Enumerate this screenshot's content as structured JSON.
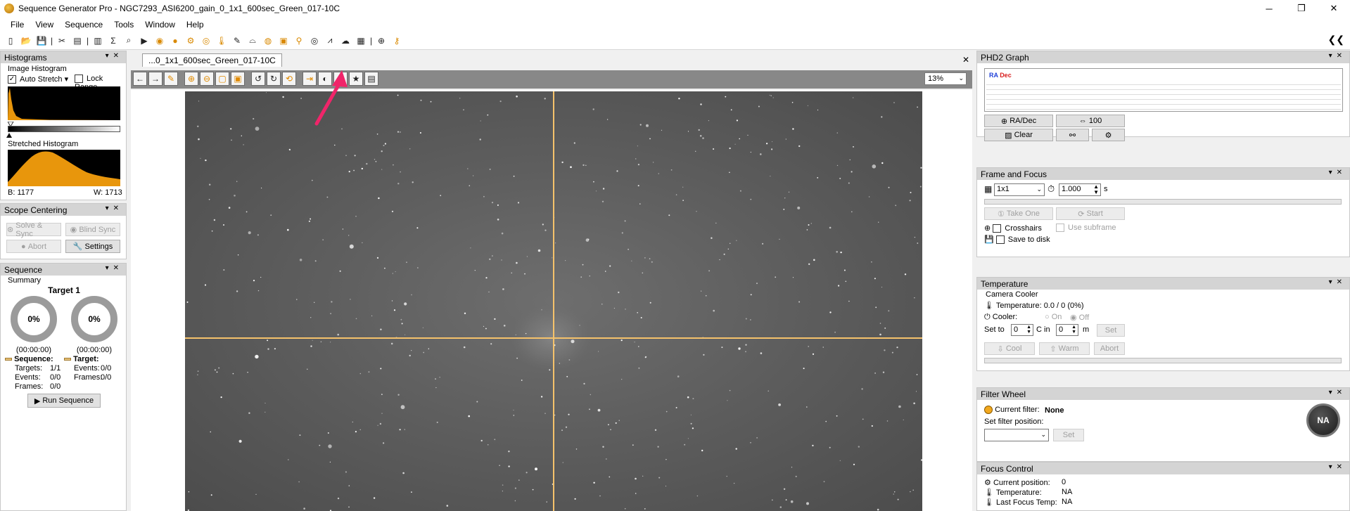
{
  "app": {
    "title": "Sequence Generator Pro - NGC7293_ASI6200_gain_0_1x1_600sec_Green_017-10C",
    "window_buttons": [
      "─",
      "❐",
      "✕"
    ]
  },
  "menu": [
    "File",
    "View",
    "Sequence",
    "Tools",
    "Window",
    "Help"
  ],
  "toolbar": {
    "right_label": "❮❮"
  },
  "histograms": {
    "title": "Histograms",
    "image_histogram_label": "Image Histogram",
    "auto_stretch_label": "Auto Stretch",
    "lock_range_label": "Lock Range",
    "stretched_histogram_label": "Stretched Histogram",
    "black_point": "B: 1177",
    "white_point": "W:   1713",
    "accent_color": "#e8960c"
  },
  "scope_centering": {
    "title": "Scope Centering",
    "solve_sync_label": "Solve & Sync",
    "blind_sync_label": "Blind Sync",
    "abort_label": "Abort",
    "settings_label": "Settings"
  },
  "sequence": {
    "title": "Sequence",
    "summary_label": "Summary",
    "target_name": "Target 1",
    "sequence_progress": "0%",
    "target_progress": "0%",
    "sequence_time": "(00:00:00)",
    "target_time": "(00:00:00)",
    "sequence_header": "Sequence:",
    "target_header": "Target:",
    "sequence_stats": [
      {
        "label": "Targets:",
        "value": "1/1"
      },
      {
        "label": "Events:",
        "value": "0/0"
      },
      {
        "label": "Frames:",
        "value": "0/0"
      }
    ],
    "target_stats": [
      {
        "label": "Events:",
        "value": "0/0"
      },
      {
        "label": "Frames:",
        "value": "0/0"
      }
    ],
    "run_label": "Run Sequence"
  },
  "document": {
    "tab_label": "...0_1x1_600sec_Green_017-10C",
    "zoom_value": "13%",
    "crosshair_color": "#f5c26b"
  },
  "phd2": {
    "title": "PHD2 Graph",
    "legend_ra": "RA",
    "legend_dec": "Dec",
    "radec_label": "RA/Dec",
    "scale_label": "100",
    "clear_label": "Clear"
  },
  "frame_focus": {
    "title": "Frame and Focus",
    "binning_value": "1x1",
    "exposure_value": "1.000",
    "exposure_unit": "s",
    "take_one_label": "Take One",
    "start_label": "Start",
    "crosshairs_label": "Crosshairs",
    "use_subframe_label": "Use subframe",
    "save_to_disk_label": "Save to disk"
  },
  "temperature": {
    "title": "Temperature",
    "camera_cooler_label": "Camera Cooler",
    "temperature_text": "Temperature: 0.0 / 0 (0%)",
    "cooler_label": "Cooler:",
    "on_label": "On",
    "off_label": "Off",
    "set_to_label": "Set to",
    "set_to_value": "0",
    "c_in_label": "C in",
    "minutes_value": "0",
    "minutes_unit": "m",
    "set_label": "Set",
    "cool_label": "Cool",
    "warm_label": "Warm",
    "abort_label": "Abort"
  },
  "filter_wheel": {
    "title": "Filter Wheel",
    "current_filter_label": "Current filter:",
    "current_filter_value": "None",
    "set_position_label": "Set filter position:",
    "set_label": "Set",
    "badge": "NA"
  },
  "focus_control": {
    "title": "Focus Control",
    "rows": [
      {
        "label": "Current position:",
        "value": "0"
      },
      {
        "label": "Temperature:",
        "value": "NA"
      },
      {
        "label": "Last Focus Temp:",
        "value": "NA"
      }
    ]
  }
}
